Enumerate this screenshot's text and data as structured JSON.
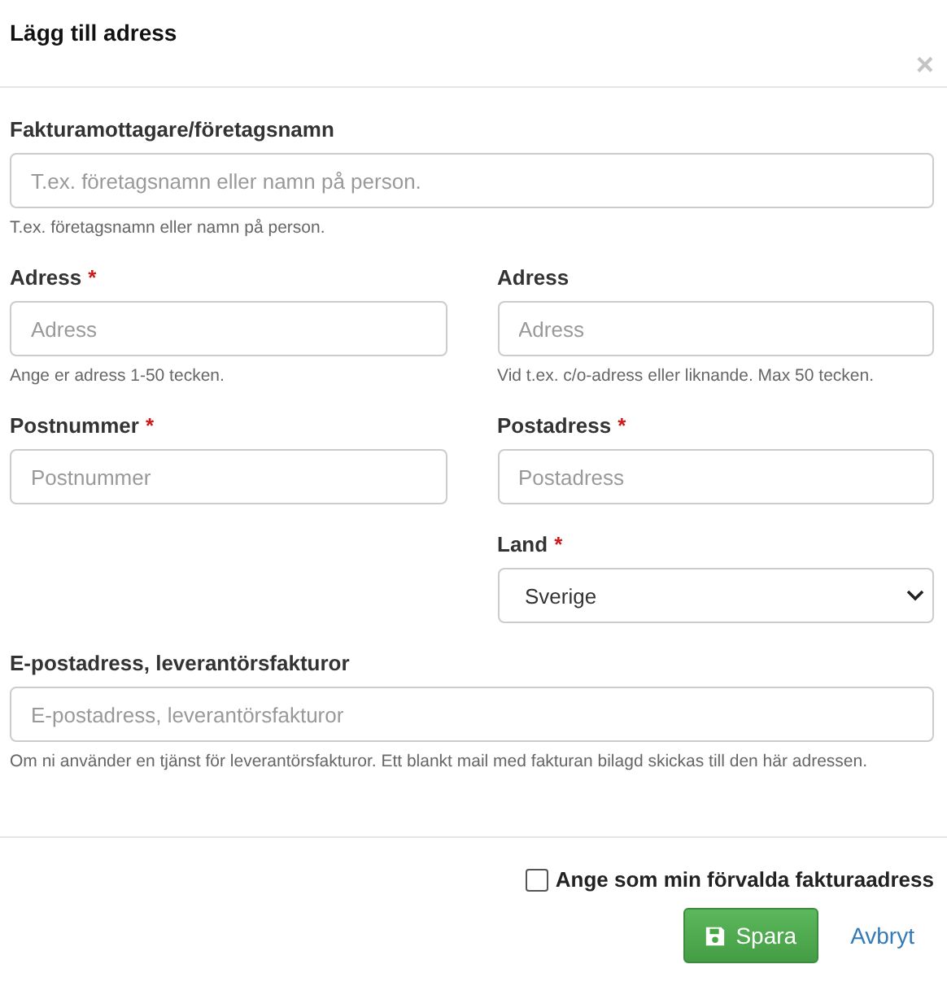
{
  "dialog": {
    "title": "Lägg till adress",
    "close": "×"
  },
  "rows": [
    {
      "full": {
        "kind": "text",
        "label": "Fakturamottagare/företagsnamn",
        "placeholder": "T.ex. företagsnamn eller namn på person.",
        "help": "T.ex. företagsnamn eller namn på person."
      }
    },
    {
      "left": {
        "kind": "text",
        "label": "Adress",
        "required_mark": "*",
        "placeholder": "Adress",
        "help": "Ange er adress 1-50 tecken."
      },
      "right": {
        "kind": "text",
        "label": "Adress",
        "placeholder": "Adress",
        "help": "Vid t.ex. c/o-adress eller liknande. Max 50 tecken."
      }
    },
    {
      "left": {
        "kind": "text",
        "label": "Postnummer",
        "required_mark": "*",
        "placeholder": "Postnummer"
      },
      "right": {
        "kind": "text",
        "label": "Postadress",
        "required_mark": "*",
        "placeholder": "Postadress"
      }
    },
    {
      "right": {
        "kind": "select",
        "label": "Land",
        "required_mark": "*",
        "value": "Sverige"
      }
    },
    {
      "full": {
        "kind": "text",
        "label": "E-postadress, leverantörsfakturor",
        "placeholder": "E-postadress, leverantörsfakturor",
        "help": "Om ni använder en tjänst för leverantörsfakturor. Ett blankt mail med fakturan bilagd skickas till den här adressen."
      }
    }
  ],
  "default_checkbox": {
    "label": "Ange som min förvalda fakturaadress",
    "checked": false
  },
  "buttons": [
    {
      "kind": "primary",
      "label": "Spara"
    },
    {
      "kind": "link",
      "label": "Avbryt"
    }
  ]
}
